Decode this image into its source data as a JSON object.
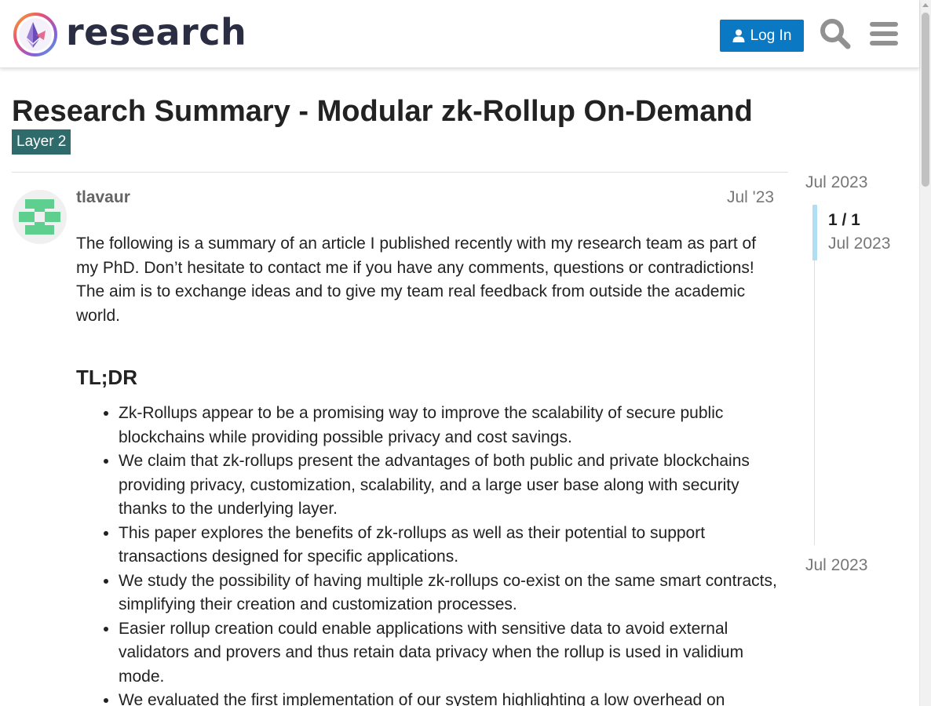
{
  "header": {
    "logo_text": "research",
    "login_label": "Log In",
    "colors": {
      "login_bg": "#0a78c2",
      "logo_text": "#2b2d42"
    }
  },
  "topic": {
    "title": "Research Summary - Modular zk-Rollup On-Demand",
    "category": "Layer 2",
    "category_color": "#2f6b6b"
  },
  "post": {
    "username": "tlavaur",
    "date": "Jul '23",
    "intro": "The following is a summary of an article I published recently with my research team as part of my PhD. Don’t hesitate to contact me if you have any comments, questions or contradictions! The aim is to exchange ideas and to give my team real feedback from outside the academic world.",
    "heading": "TL;DR",
    "bullets": [
      "Zk-Rollups appear to be a promising way to improve the scalability of secure public blockchains while providing possible privacy and cost savings.",
      "We claim that zk-rollups present the advantages of both public and private blockchains providing privacy, customization, scalability, and a large user base along with security thanks to the underlying layer.",
      "This paper explores the benefits of zk-rollups as well as their potential to support transactions designed for specific applications.",
      "We study the possibility of having multiple zk-rollups co-exist on the same smart contracts, simplifying their creation and customization processes.",
      "Easier rollup creation could enable applications with sensitive data to avoid external validators and provers and thus retain data privacy when the rollup is used in validium mode.",
      "We evaluated the first implementation of our system highlighting a low overhead on"
    ]
  },
  "timeline": {
    "top_date": "Jul 2023",
    "count": "1 / 1",
    "count_date": "Jul 2023",
    "bottom_date": "Jul 2023"
  },
  "icons": [
    "logo-icon",
    "user-icon",
    "search-icon",
    "menu-icon"
  ]
}
